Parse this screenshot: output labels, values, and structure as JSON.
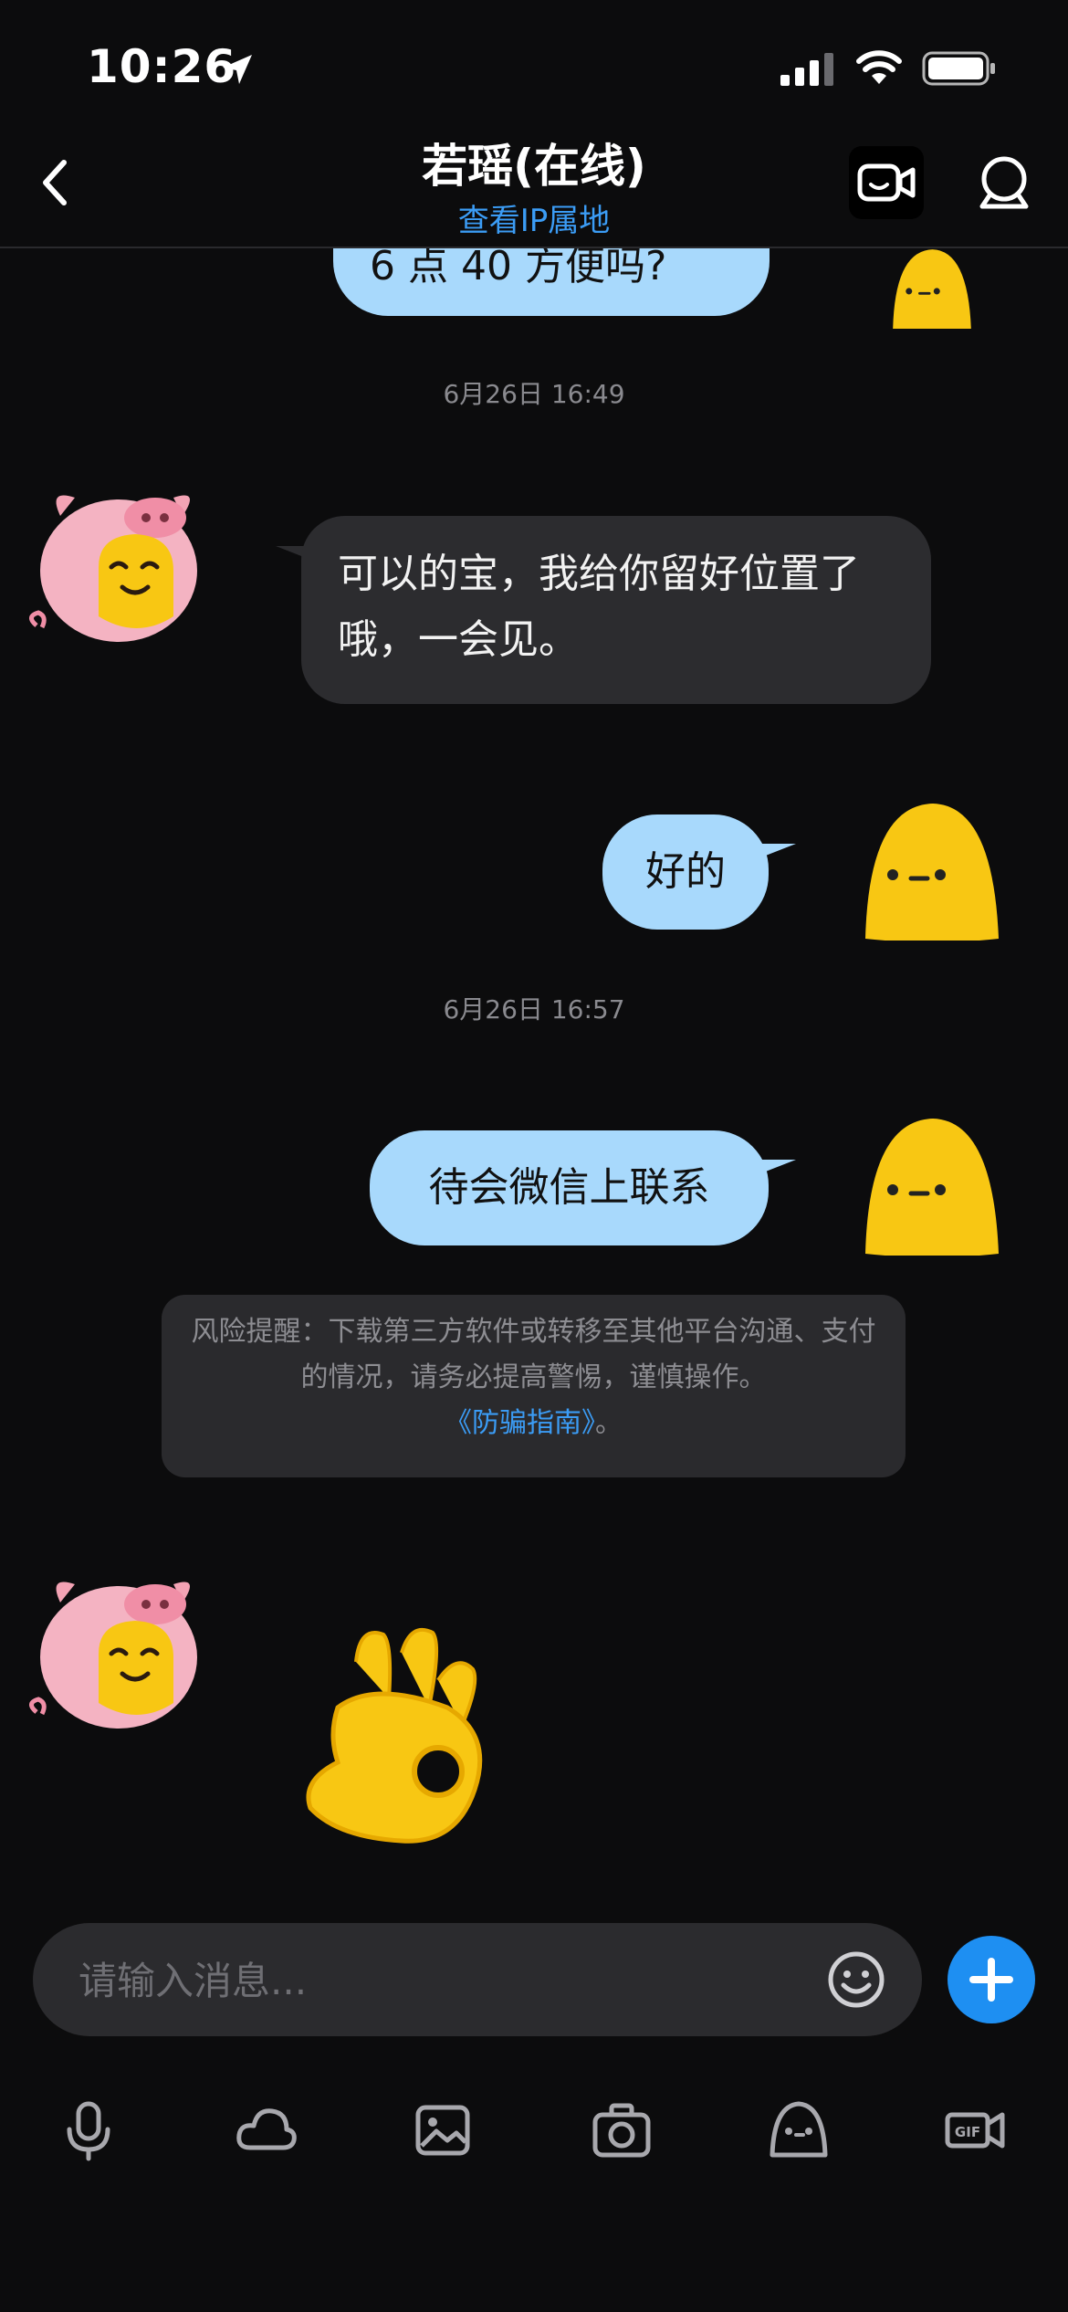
{
  "status_bar": {
    "time": "10:26"
  },
  "header": {
    "title": "若瑶(在线)",
    "subtitle": "查看IP属地"
  },
  "messages": {
    "partial_top_text": "6 点 40 方便吗?",
    "timestamp_1": "6月26日 16:49",
    "incoming_1": "可以的宝，我给你留好位置了哦，一会见。",
    "outgoing_1": "好的",
    "timestamp_2": "6月26日 16:57",
    "outgoing_2": "待会微信上联系",
    "risk_notice": {
      "text": "风险提醒：下载第三方软件或转移至其他平台沟通、支付的情况，请务必提高警惕，谨慎操作。",
      "link": "《防骗指南》",
      "end": "。"
    }
  },
  "input": {
    "placeholder": "请输入消息..."
  },
  "toolbar": [
    "mic-icon",
    "cloud-icon",
    "image-icon",
    "camera-icon",
    "sticker-icon",
    "gif-icon"
  ],
  "colors": {
    "accent": "#1e8ff2",
    "outgoing_bubble": "#a8d9fc",
    "incoming_bubble": "#2c2c2f",
    "link": "#3b9cf5"
  }
}
